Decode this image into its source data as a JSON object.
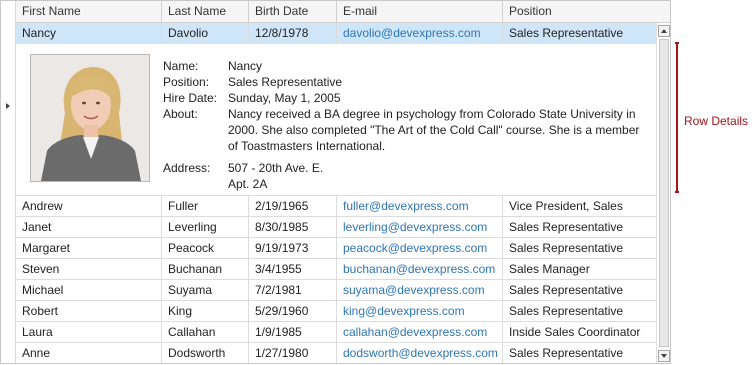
{
  "columns": [
    "First Name",
    "Last Name",
    "Birth Date",
    "E-mail",
    "Position"
  ],
  "selected_row": {
    "first": "Nancy",
    "last": "Davolio",
    "birth": "12/8/1978",
    "email": "davolio@devexpress.com",
    "position": "Sales Representative"
  },
  "details": {
    "name_label": "Name:",
    "name": "Nancy",
    "position_label": "Position:",
    "position": "Sales Representative",
    "hire_label": "Hire Date:",
    "hire": "Sunday, May 1, 2005",
    "about_label": "About:",
    "about": "Nancy received a BA degree in psychology from Colorado State University in 2000. She also completed \"The Art of the Cold Call\" course. She is a member of Toastmasters International.",
    "address_label": "Address:",
    "address_line1": "507 - 20th Ave. E.",
    "address_line2": "Apt. 2A"
  },
  "rows": [
    {
      "first": "Andrew",
      "last": "Fuller",
      "birth": "2/19/1965",
      "email": "fuller@devexpress.com",
      "position": "Vice President, Sales"
    },
    {
      "first": "Janet",
      "last": "Leverling",
      "birth": "8/30/1985",
      "email": "leverling@devexpress.com",
      "position": "Sales Representative"
    },
    {
      "first": "Margaret",
      "last": "Peacock",
      "birth": "9/19/1973",
      "email": "peacock@devexpress.com",
      "position": "Sales Representative"
    },
    {
      "first": "Steven",
      "last": "Buchanan",
      "birth": "3/4/1955",
      "email": "buchanan@devexpress.com",
      "position": "Sales Manager"
    },
    {
      "first": "Michael",
      "last": "Suyama",
      "birth": "7/2/1981",
      "email": "suyama@devexpress.com",
      "position": "Sales Representative"
    },
    {
      "first": "Robert",
      "last": "King",
      "birth": "5/29/1960",
      "email": "king@devexpress.com",
      "position": "Sales Representative"
    },
    {
      "first": "Laura",
      "last": "Callahan",
      "birth": "1/9/1985",
      "email": "callahan@devexpress.com",
      "position": "Inside Sales Coordinator"
    },
    {
      "first": "Anne",
      "last": "Dodsworth",
      "birth": "1/27/1980",
      "email": "dodsworth@devexpress.com",
      "position": "Sales Representative"
    }
  ],
  "callout": "Row Details",
  "colors": {
    "selection": "#cfe6f8",
    "email_link": "#2e75b6",
    "callout": "#a3151b"
  },
  "icons": {
    "row_indicator": "triangle-right-icon",
    "scroll_up": "chevron-up-icon",
    "scroll_down": "chevron-down-icon"
  }
}
